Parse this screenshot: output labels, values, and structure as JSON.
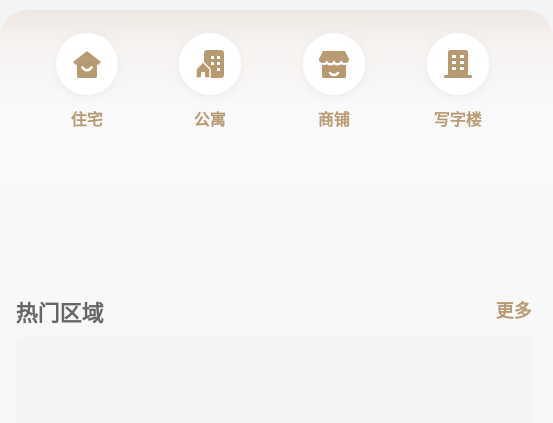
{
  "categories": [
    {
      "label": "住宅",
      "icon": "house-icon"
    },
    {
      "label": "公寓",
      "icon": "apartment-building-icon"
    },
    {
      "label": "商铺",
      "icon": "shop-icon"
    },
    {
      "label": "写字楼",
      "icon": "office-building-icon"
    }
  ],
  "hot_areas": {
    "title": "热门区域",
    "more_label": "更多"
  },
  "colors": {
    "accent": "#b79a72",
    "title_text": "#666666",
    "background": "#f3f4f6",
    "card_background": "#f8f8f8"
  }
}
